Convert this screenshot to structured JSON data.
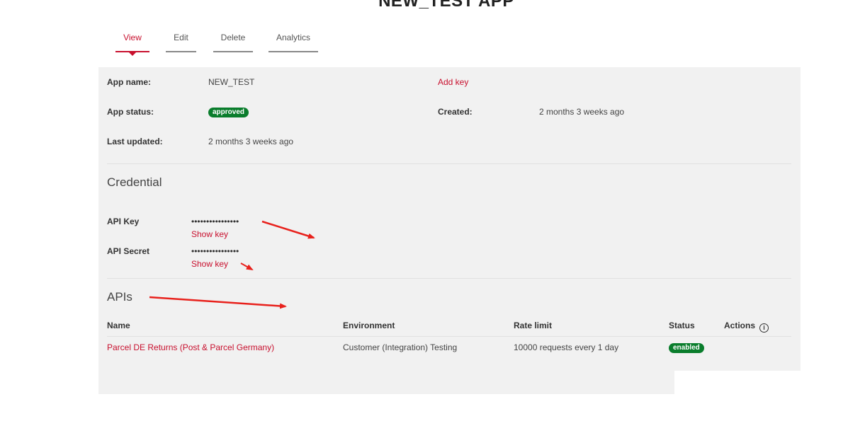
{
  "page": {
    "title": "NEW_TEST APP"
  },
  "tabs": [
    {
      "label": "View",
      "active": true
    },
    {
      "label": "Edit",
      "active": false
    },
    {
      "label": "Delete",
      "active": false
    },
    {
      "label": "Analytics",
      "active": false
    }
  ],
  "details": {
    "app_name_label": "App name:",
    "app_name_value": "NEW_TEST",
    "add_key_label": "Add key",
    "app_status_label": "App status:",
    "app_status_value": "approved",
    "created_label": "Created:",
    "created_value": "2 months 3 weeks ago",
    "last_updated_label": "Last updated:",
    "last_updated_value": "2 months 3 weeks ago"
  },
  "credential": {
    "heading": "Credential",
    "api_key_label": "API Key",
    "api_key_masked": "••••••••••••••••",
    "api_key_show": "Show key",
    "api_secret_label": "API Secret",
    "api_secret_masked": "••••••••••••••••",
    "api_secret_show": "Show key"
  },
  "apis": {
    "heading": "APIs",
    "columns": [
      "Name",
      "Environment",
      "Rate limit",
      "Status",
      "Actions"
    ],
    "rows": [
      {
        "name": "Parcel DE Returns (Post & Parcel Germany)",
        "environment": "Customer (Integration) Testing",
        "rate_limit": "10000 requests every 1 day",
        "status": "enabled"
      }
    ]
  },
  "colors": {
    "accent": "#c8102e",
    "success": "#0a7d2c",
    "panel_bg": "#f1f1f1",
    "annotation_arrow": "#e8211c"
  },
  "icons": {
    "actions_info": "info-icon"
  }
}
